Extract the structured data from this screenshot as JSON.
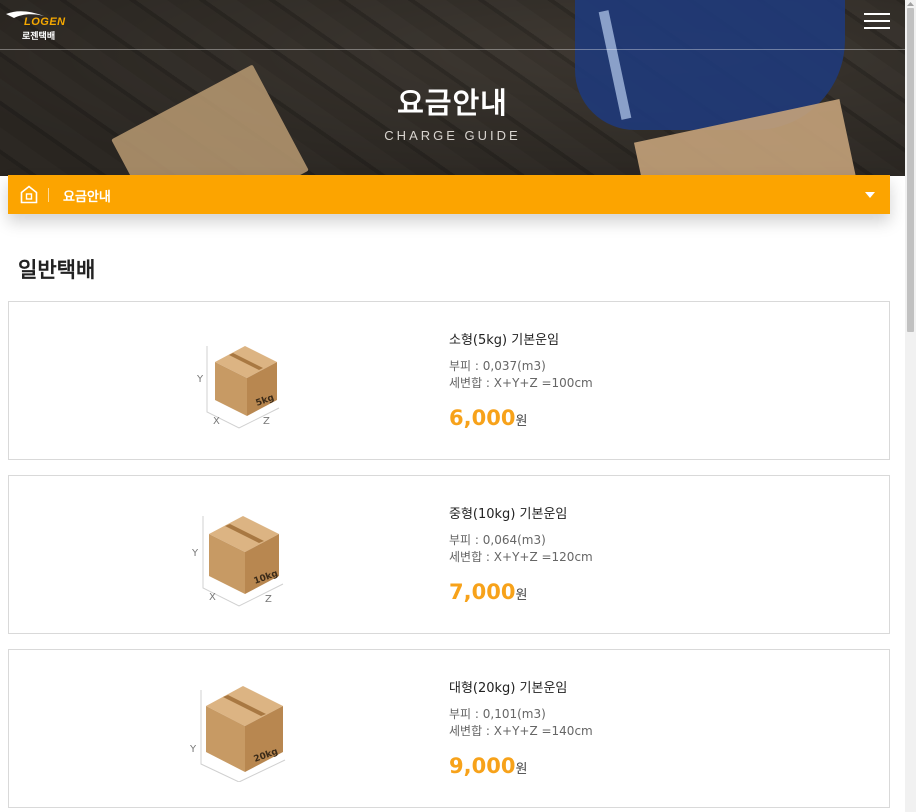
{
  "header": {
    "logo_top": "LOGEN",
    "logo_bottom": "로젠택배",
    "title": "요금안내",
    "subtitle": "CHARGE GUIDE"
  },
  "breadcrumb": {
    "label": "요금안내"
  },
  "section": {
    "title": "일반택배"
  },
  "box_axis": {
    "x": "X",
    "y": "Y",
    "z": "Z"
  },
  "cards": [
    {
      "name": "소형(5kg) 기본운임",
      "volume": "부피 : 0,037(m3)",
      "sum": "세변합 : X+Y+Z =100cm",
      "price": "6,000",
      "unit": "원",
      "box_label": "5kg"
    },
    {
      "name": "중형(10kg) 기본운임",
      "volume": "부피 : 0,064(m3)",
      "sum": "세변합 : X+Y+Z =120cm",
      "price": "7,000",
      "unit": "원",
      "box_label": "10kg"
    },
    {
      "name": "대형(20kg) 기본운임",
      "volume": "부피 : 0,101(m3)",
      "sum": "세변합 : X+Y+Z =140cm",
      "price": "9,000",
      "unit": "원",
      "box_label": "20kg"
    }
  ],
  "colors": {
    "accent": "#fca400",
    "price": "#f7a21a",
    "box": "#c79a64"
  },
  "icons": [
    "logo-wing-icon",
    "menu-icon",
    "home-icon",
    "caret-down-icon",
    "box-icon"
  ]
}
